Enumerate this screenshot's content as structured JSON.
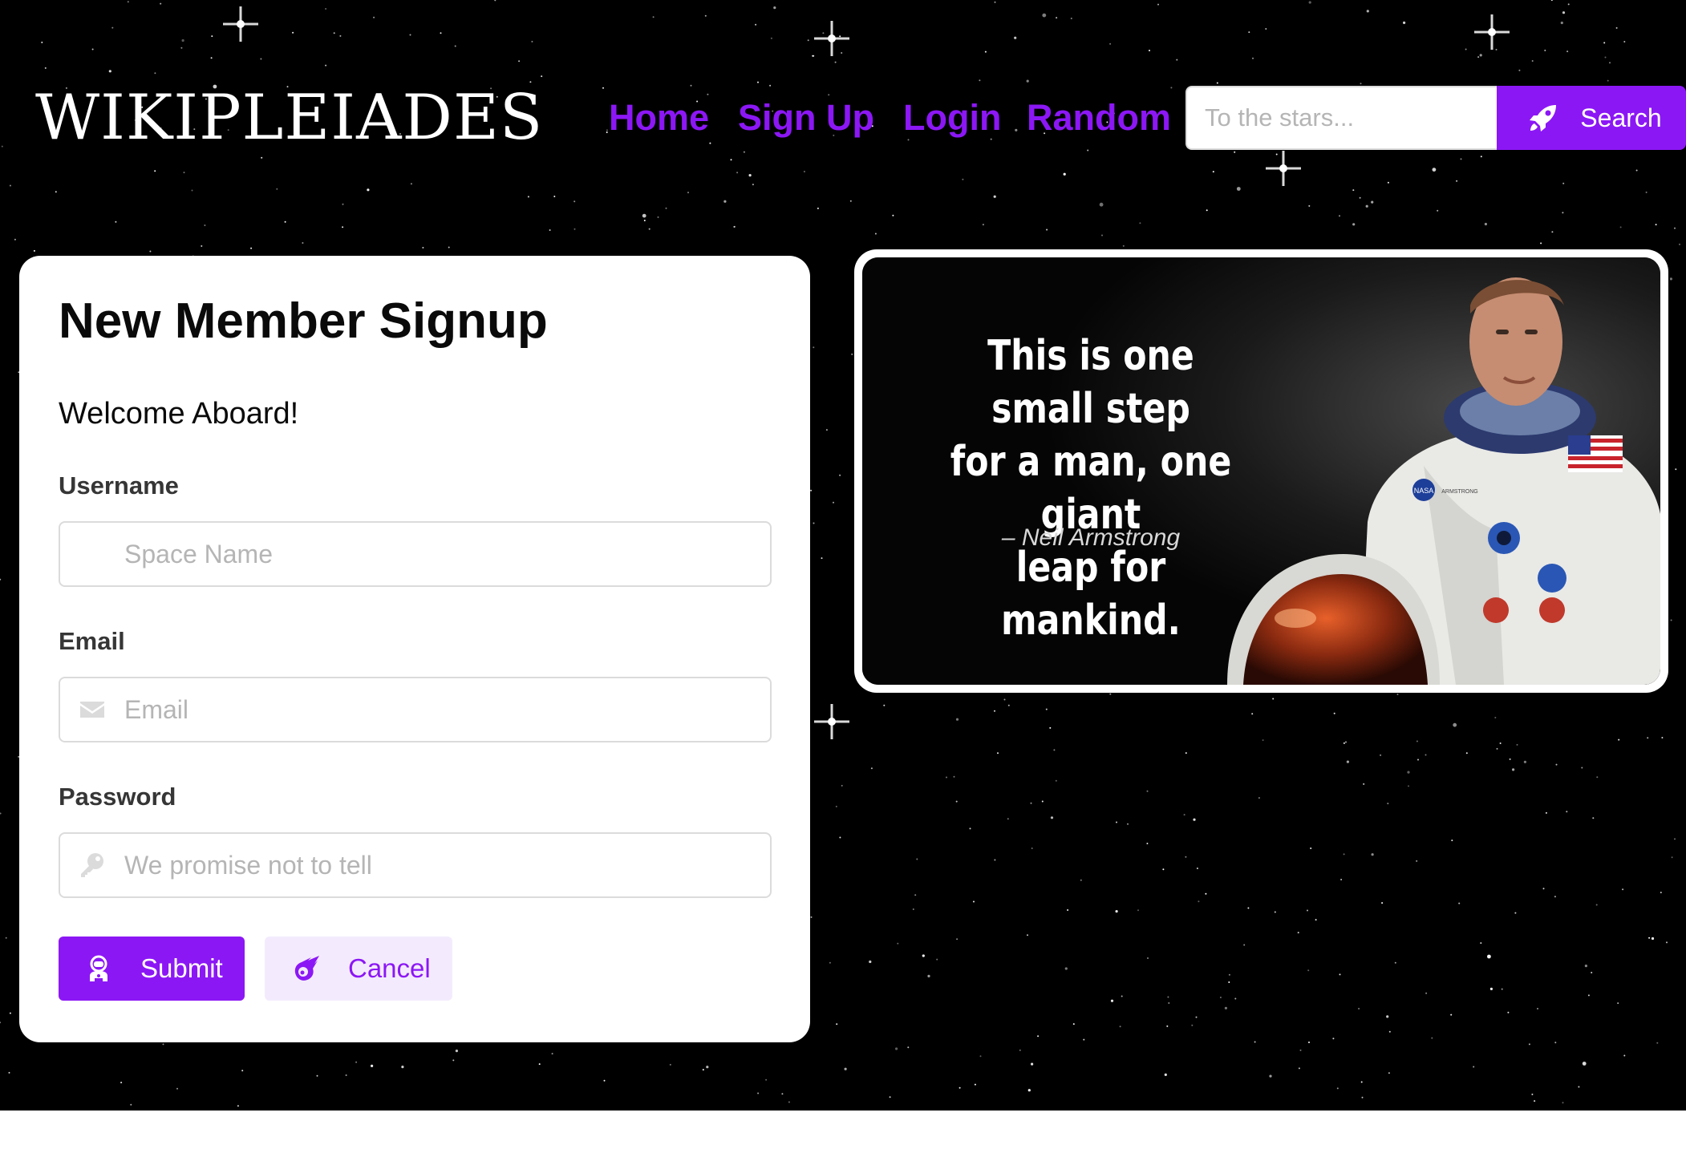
{
  "site": {
    "brand": "WIKIPLEIADES"
  },
  "nav": {
    "links": [
      {
        "label": "Home"
      },
      {
        "label": "Sign Up"
      },
      {
        "label": "Login"
      },
      {
        "label": "Random"
      }
    ],
    "search": {
      "placeholder": "To the stars...",
      "value": "",
      "button_label": "Search",
      "button_icon": "rocket-icon"
    }
  },
  "signup": {
    "title": "New Member Signup",
    "welcome": "Welcome Aboard!",
    "fields": {
      "username": {
        "label": "Username",
        "placeholder": "Space Name",
        "value": "",
        "icon": "none"
      },
      "email": {
        "label": "Email",
        "placeholder": "Email",
        "value": "",
        "icon": "envelope-icon"
      },
      "password": {
        "label": "Password",
        "placeholder": "We promise not to tell",
        "value": "",
        "icon": "key-icon"
      }
    },
    "buttons": {
      "submit": {
        "label": "Submit",
        "icon": "astronaut-icon"
      },
      "cancel": {
        "label": "Cancel",
        "icon": "meteor-icon"
      }
    }
  },
  "quote": {
    "line1": "This is one small step",
    "line2": "for a man, one giant",
    "line3": "leap for mankind.",
    "author": "– Neil Armstrong",
    "patch_text": "NASA",
    "name_tag": "ARMSTRONG"
  },
  "colors": {
    "accent": "#8c17f5",
    "accent_light": "#f3ebfd",
    "background": "#000000",
    "card": "#ffffff"
  }
}
